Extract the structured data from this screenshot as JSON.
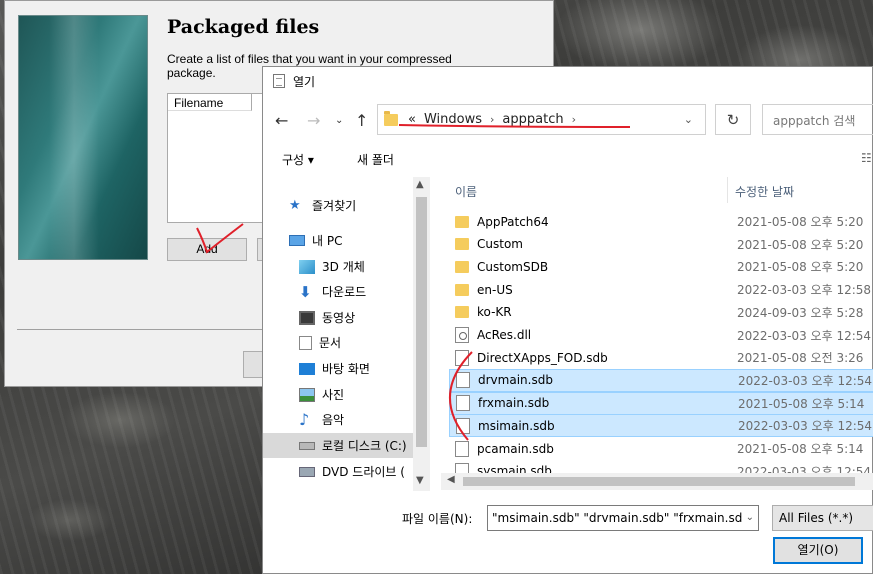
{
  "wizard": {
    "title": "Packaged files",
    "description": "Create a list of files that you want in your compressed package.",
    "col_filename": "Filename",
    "add_button": "Add"
  },
  "dialog": {
    "title": "열기",
    "address": {
      "overflow": "«",
      "segments": [
        "Windows",
        "apppatch"
      ]
    },
    "search_placeholder": "apppatch 검색",
    "toolbar": {
      "organize": "구성 ▾",
      "new_folder": "새 폴더"
    },
    "nav": [
      {
        "label": "즐겨찾기",
        "icon": "star-icon"
      },
      {
        "label": "내 PC",
        "icon": "pc-icon"
      },
      {
        "label": "3D 개체",
        "icon": "cube-icon"
      },
      {
        "label": "다운로드",
        "icon": "download-icon"
      },
      {
        "label": "동영상",
        "icon": "video-icon"
      },
      {
        "label": "문서",
        "icon": "document-icon"
      },
      {
        "label": "바탕 화면",
        "icon": "desktop-icon"
      },
      {
        "label": "사진",
        "icon": "picture-icon"
      },
      {
        "label": "음악",
        "icon": "music-icon"
      },
      {
        "label": "로컬 디스크 (C:)",
        "icon": "disk-icon"
      },
      {
        "label": "DVD 드라이브 (",
        "icon": "dvd-icon"
      }
    ],
    "columns": {
      "name": "이름",
      "date": "수정한 날짜"
    },
    "files": [
      {
        "name": "AppPatch64",
        "date": "2021-05-08 오후 5:20",
        "type": "folder",
        "selected": false
      },
      {
        "name": "Custom",
        "date": "2021-05-08 오후 5:20",
        "type": "folder",
        "selected": false
      },
      {
        "name": "CustomSDB",
        "date": "2021-05-08 오후 5:20",
        "type": "folder",
        "selected": false
      },
      {
        "name": "en-US",
        "date": "2022-03-03 오후 12:58",
        "type": "folder",
        "selected": false
      },
      {
        "name": "ko-KR",
        "date": "2024-09-03 오후 5:28",
        "type": "folder",
        "selected": false
      },
      {
        "name": "AcRes.dll",
        "date": "2022-03-03 오후 12:54",
        "type": "dll",
        "selected": false
      },
      {
        "name": "DirectXApps_FOD.sdb",
        "date": "2021-05-08 오전 3:26",
        "type": "file",
        "selected": false
      },
      {
        "name": "drvmain.sdb",
        "date": "2022-03-03 오후 12:54",
        "type": "file",
        "selected": true
      },
      {
        "name": "frxmain.sdb",
        "date": "2021-05-08 오후 5:14",
        "type": "file",
        "selected": true
      },
      {
        "name": "msimain.sdb",
        "date": "2022-03-03 오후 12:54",
        "type": "file",
        "selected": true
      },
      {
        "name": "pcamain.sdb",
        "date": "2021-05-08 오후 5:14",
        "type": "file",
        "selected": false
      },
      {
        "name": "sysmain.sdb",
        "date": "2022-03-03 오후 12:54",
        "type": "file",
        "selected": false
      }
    ],
    "filename_label": "파일 이름(N):",
    "filename_value": "\"msimain.sdb\" \"drvmain.sdb\" \"frxmain.sdb",
    "filetype": "All Files (*.*)",
    "open_button": "열기(O)"
  },
  "colors": {
    "selection": "#cce8ff",
    "accent": "#0078d7",
    "annotation": "#e0202a"
  }
}
